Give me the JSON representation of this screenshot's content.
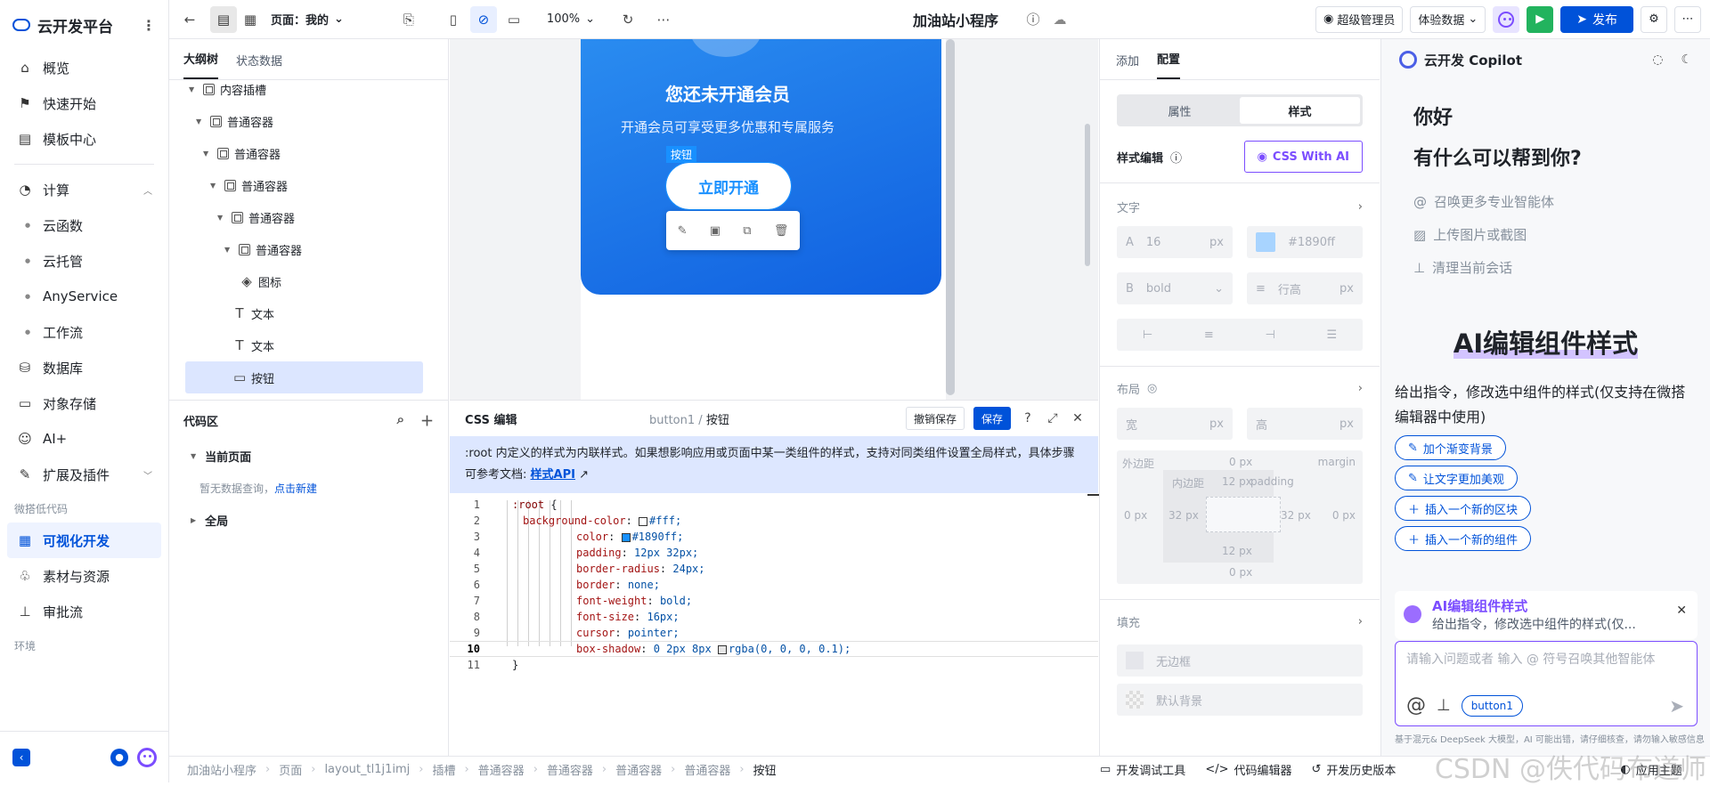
{
  "sidebar": {
    "brand": "云开发平台",
    "items": [
      {
        "label": "概览",
        "icon": "home-icon"
      },
      {
        "label": "快速开始",
        "icon": "flag-icon"
      },
      {
        "label": "模板中心",
        "icon": "template-icon"
      }
    ],
    "compute": {
      "label": "计算",
      "children": [
        "云函数",
        "云托管",
        "AnyService",
        "工作流"
      ]
    },
    "items2": [
      {
        "label": "数据库",
        "icon": "database-icon"
      },
      {
        "label": "对象存储",
        "icon": "folder-icon"
      },
      {
        "label": "AI+",
        "icon": "robot-icon"
      },
      {
        "label": "扩展及插件",
        "icon": "plugin-icon"
      }
    ],
    "section_lowcode": "微搭低代码",
    "lowcode_items": [
      {
        "label": "可视化开发",
        "active": true
      },
      {
        "label": "素材与资源"
      },
      {
        "label": "审批流"
      }
    ],
    "section_env": "环境"
  },
  "topbar": {
    "page_label": "页面：我的",
    "zoom": "100%",
    "app_title": "加油站小程序",
    "admin": "超级管理员",
    "data_mode": "体验数据",
    "publish": "发布"
  },
  "tree": {
    "tabs": [
      "大纲树",
      "状态数据"
    ],
    "nodes": [
      {
        "label": "内容插槽",
        "indent": 22,
        "type": "container"
      },
      {
        "label": "普通容器",
        "indent": 30,
        "type": "container"
      },
      {
        "label": "普通容器",
        "indent": 38,
        "type": "container"
      },
      {
        "label": "普通容器",
        "indent": 46,
        "type": "container"
      },
      {
        "label": "普通容器",
        "indent": 54,
        "type": "container"
      },
      {
        "label": "普通容器",
        "indent": 62,
        "type": "container"
      },
      {
        "label": "图标",
        "indent": 80,
        "type": "icon"
      },
      {
        "label": "文本",
        "indent": 72,
        "type": "text"
      },
      {
        "label": "文本",
        "indent": 72,
        "type": "text"
      },
      {
        "label": "按钮",
        "indent": 72,
        "type": "button",
        "selected": true
      }
    ]
  },
  "codearea": {
    "title": "代码区",
    "current_page": "当前页面",
    "empty_text": "暂无数据查询，",
    "empty_link": "点击新建",
    "global": "全局"
  },
  "canvas": {
    "hero_title": "您还未开通会员",
    "hero_sub": "开通会员可享受更多优惠和专属服务",
    "selected_tag": "按钮",
    "button_label": "立即开通"
  },
  "csseditor": {
    "title": "CSS 编辑",
    "crumb_root": "button1",
    "crumb_sep": " / ",
    "crumb_leaf": "按钮",
    "undo_label": "撤销保存",
    "save_label": "保存",
    "notice": ":root 内定义的样式为内联样式。如果想影响应用或页面中某一类组件的样式，支持对同类组件设置全局样式，具体步骤可参考文档:",
    "notice_link": "样式API",
    "lines": [
      {
        "n": "1",
        "sel": ":root",
        "open": " {"
      },
      {
        "n": "2",
        "prop": "background-color",
        "swatch": "#ffffff",
        "val": "#fff;"
      },
      {
        "n": "3",
        "prop": "color",
        "swatch": "#1890ff",
        "val": "#1890ff;"
      },
      {
        "n": "4",
        "prop": "padding",
        "val": "12px 32px;"
      },
      {
        "n": "5",
        "prop": "border-radius",
        "val": "24px;"
      },
      {
        "n": "6",
        "prop": "border",
        "val": "none;"
      },
      {
        "n": "7",
        "prop": "font-weight",
        "val": "bold;"
      },
      {
        "n": "8",
        "prop": "font-size",
        "val": "16px;"
      },
      {
        "n": "9",
        "prop": "cursor",
        "val": "pointer;"
      },
      {
        "n": "10",
        "prop": "box-shadow",
        "val": "0 2px 8px ",
        "swatch": "#e6e6e6",
        "val2": "rgba(0, 0, 0, 0.1);",
        "current": true
      },
      {
        "n": "11",
        "close": "}"
      }
    ]
  },
  "props": {
    "tabs": [
      "添加",
      "配置"
    ],
    "seg": [
      "属性",
      "样式"
    ],
    "style_edit": "样式编辑",
    "css_ai": "CSS With AI",
    "text_section": "文字",
    "font_size": "16",
    "unit": "px",
    "color_hex": "#1890ff",
    "font_weight": "bold",
    "line_height_ph": "行高",
    "layout_section": "布局",
    "width": "宽",
    "height": "高",
    "margin_label": "外边距",
    "margin_word": "margin",
    "padding_label": "内边距",
    "padding_word": "padding",
    "m_top": "0 px",
    "p_top": "12 px",
    "m_left": "0 px",
    "p_left": "32 px",
    "p_right": "32 px",
    "m_right": "0 px",
    "p_bottom": "12 px",
    "m_bottom": "0 px",
    "fill_section": "填充",
    "no_border": "无边框",
    "default_bg": "默认背景"
  },
  "copilot": {
    "title": "云开发 Copilot",
    "hello1": "你好",
    "hello2": "有什么可以帮到你?",
    "options": [
      "召唤更多专业智能体",
      "上传图片或截图",
      "清理当前会话"
    ],
    "ai_title": "AI编辑组件样式",
    "ai_desc": "给出指令，修改选中组件的样式(仅支持在微搭编辑器中使用)",
    "chips": [
      "加个渐变背景",
      "让文字更加美观",
      "插入一个新的区块",
      "插入一个新的组件"
    ],
    "ctx_title": "AI编辑组件样式",
    "ctx_desc": "给出指令，修改选中组件的样式(仅...",
    "input_placeholder": "请输入问题或者 输入 @ 符号召唤其他智能体",
    "input_tag": "button1",
    "disclaimer": "基于混元& DeepSeek 大模型，AI 可能出错，请仔细核查，请勿输入敏感信息"
  },
  "bottombar": {
    "crumbs": [
      "加油站小程序",
      "页面",
      "layout_tl1j1imj",
      "插槽",
      "普通容器",
      "普通容器",
      "普通容器",
      "普通容器",
      "按钮"
    ],
    "tools": [
      "开发调试工具",
      "代码编辑器",
      "开发历史版本",
      "应用主题"
    ],
    "watermark": "CSDN @佚代码布道师"
  }
}
